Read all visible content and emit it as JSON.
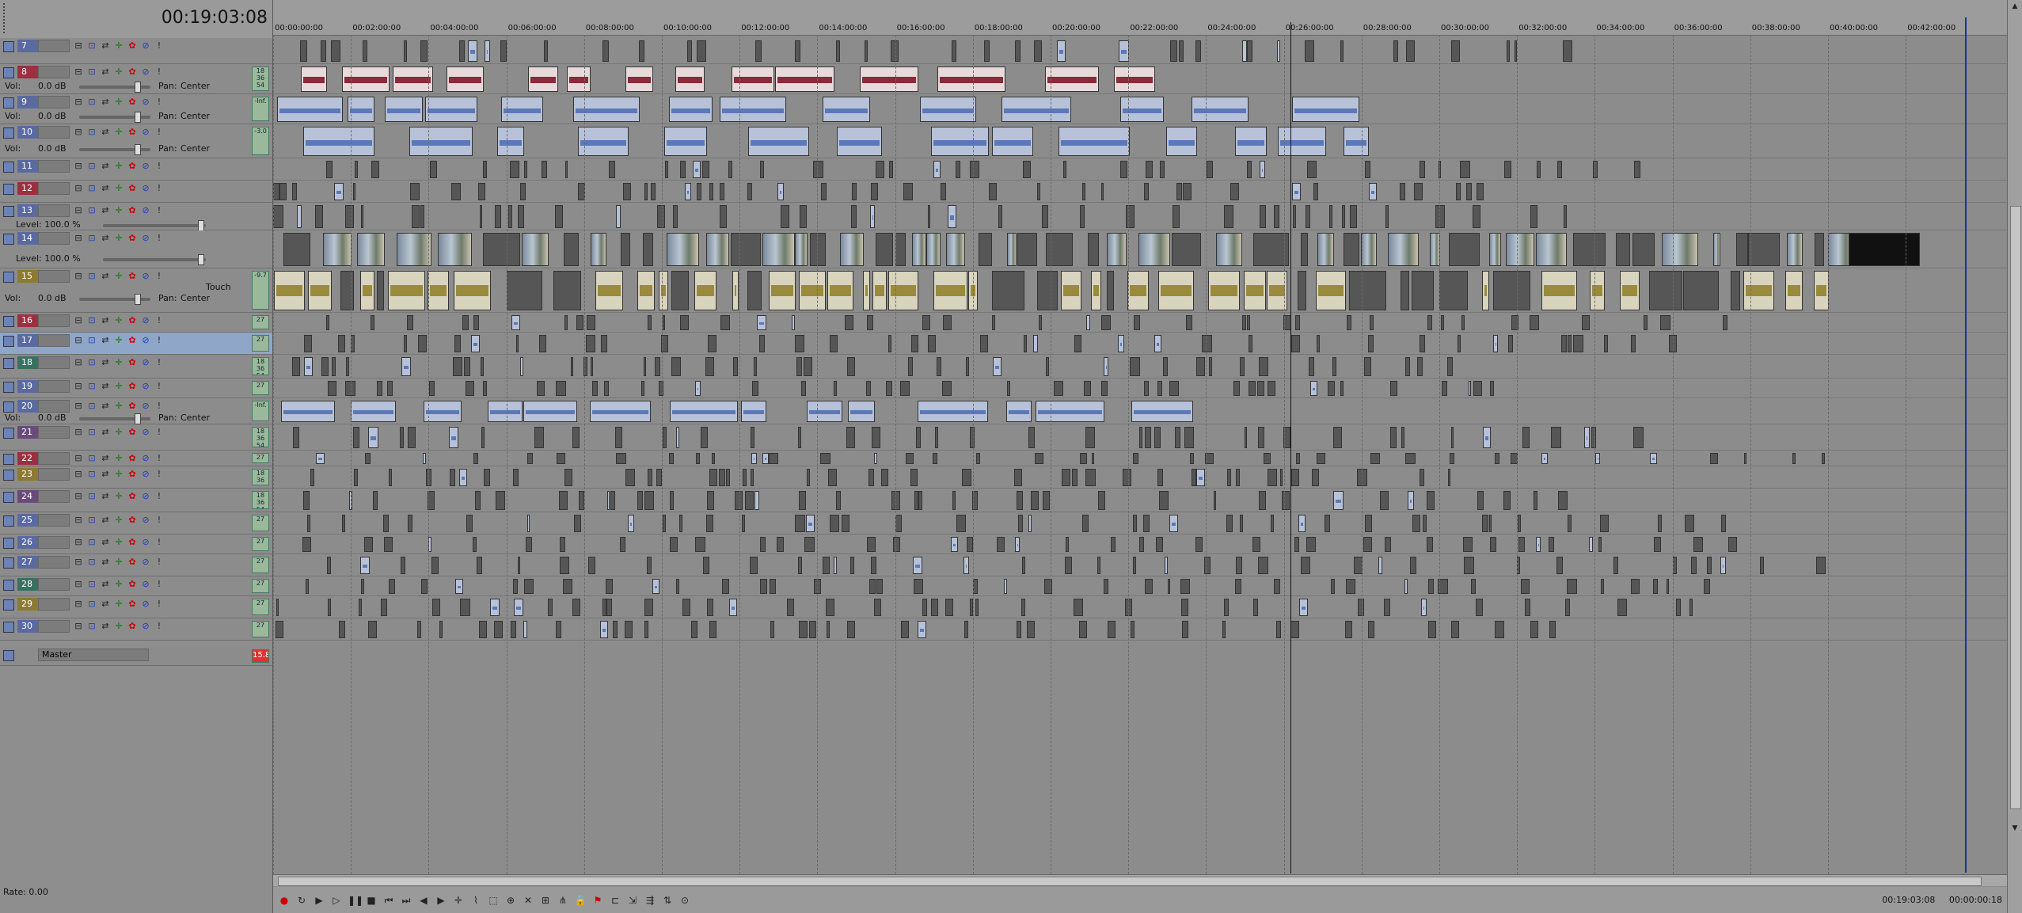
{
  "timecode": "00:19:03:08",
  "ruler_ticks": [
    "00:00:00:00",
    "00:02:00:00",
    "00:04:00:00",
    "00:06:00:00",
    "00:08:00:00",
    "00:10:00:00",
    "00:12:00:00",
    "00:14:00:00",
    "00:16:00:00",
    "00:18:00:00",
    "00:20:00:00",
    "00:22:00:00",
    "00:24:00:00",
    "00:26:00:00",
    "00:28:00:00",
    "00:30:00:00",
    "00:32:00:00",
    "00:34:00:00",
    "00:36:00:00",
    "00:38:00:00",
    "00:40:00:00",
    "00:42:00:00"
  ],
  "tracks": [
    {
      "num": "7",
      "type": "video",
      "color": "#5a6aa0"
    },
    {
      "num": "8",
      "type": "audio",
      "color": "#9c3040",
      "vol": "Vol:",
      "vol_value": "0.0 dB",
      "pan": "Pan:",
      "pan_value": "Center",
      "meter": "18 36 54"
    },
    {
      "num": "9",
      "type": "audio",
      "color": "#5a6aa0",
      "vol": "Vol:",
      "vol_value": "0.0 dB",
      "pan": "Pan:",
      "pan_value": "Center",
      "meter": "-Inf."
    },
    {
      "num": "10",
      "type": "audio",
      "color": "#5a6aa0",
      "vol": "Vol:",
      "vol_value": "0.0 dB",
      "pan": "Pan:",
      "pan_value": "Center",
      "meter": "-3.0"
    },
    {
      "num": "11",
      "type": "video",
      "color": "#5a6aa0"
    },
    {
      "num": "12",
      "type": "video",
      "color": "#9c3040"
    },
    {
      "num": "13",
      "type": "video",
      "color": "#5a6aa0",
      "level": "Level: 100.0 %"
    },
    {
      "num": "14",
      "type": "video",
      "color": "#5a6aa0",
      "level": "Level: 100.0 %"
    },
    {
      "num": "15",
      "type": "audio",
      "color": "#8c7a30",
      "vol": "Vol:",
      "vol_value": "0.0 dB",
      "pan": "Pan:",
      "pan_value": "Center",
      "mode": "Touch",
      "meter": "-9.7"
    },
    {
      "num": "16",
      "type": "video",
      "color": "#9c3040",
      "meter": "27"
    },
    {
      "num": "17",
      "type": "video",
      "color": "#5a6aa0",
      "meter": "27",
      "selected": true
    },
    {
      "num": "18",
      "type": "video",
      "color": "#3a7060",
      "meter": "18 36 54"
    },
    {
      "num": "19",
      "type": "video",
      "color": "#5a6aa0",
      "meter": "27"
    },
    {
      "num": "20",
      "type": "audio",
      "color": "#5a6aa0",
      "vol": "Vol:",
      "vol_value": "0.0 dB",
      "pan": "Pan:",
      "pan_value": "Center",
      "meter": "-Inf."
    },
    {
      "num": "21",
      "type": "video",
      "color": "#6a4a7a",
      "meter": "18 36 54"
    },
    {
      "num": "22",
      "type": "video",
      "color": "#9c3040",
      "meter": "27"
    },
    {
      "num": "23",
      "type": "video",
      "color": "#8c7a30",
      "meter": "18 36 54"
    },
    {
      "num": "24",
      "type": "video",
      "color": "#6a4a7a",
      "meter": "18 36 54"
    },
    {
      "num": "25",
      "type": "video",
      "color": "#5a6aa0",
      "meter": "27"
    },
    {
      "num": "26",
      "type": "video",
      "color": "#5a6aa0",
      "meter": "27"
    },
    {
      "num": "27",
      "type": "video",
      "color": "#5a6aa0",
      "meter": "27"
    },
    {
      "num": "28",
      "type": "video",
      "color": "#3a7060",
      "meter": "27"
    },
    {
      "num": "29",
      "type": "video",
      "color": "#8c7a30",
      "meter": "27"
    },
    {
      "num": "30",
      "type": "video",
      "color": "#5a6aa0",
      "meter": "27"
    }
  ],
  "master": {
    "label": "Master",
    "meter": "15.8"
  },
  "rate": "Rate: 0.00",
  "status_time": "00:19:03:08",
  "status_right": "00:00:00:18",
  "colors": {
    "cursor": "#1e2f9e",
    "record": "#cc0000",
    "audio_clip": "#5b78b8"
  }
}
